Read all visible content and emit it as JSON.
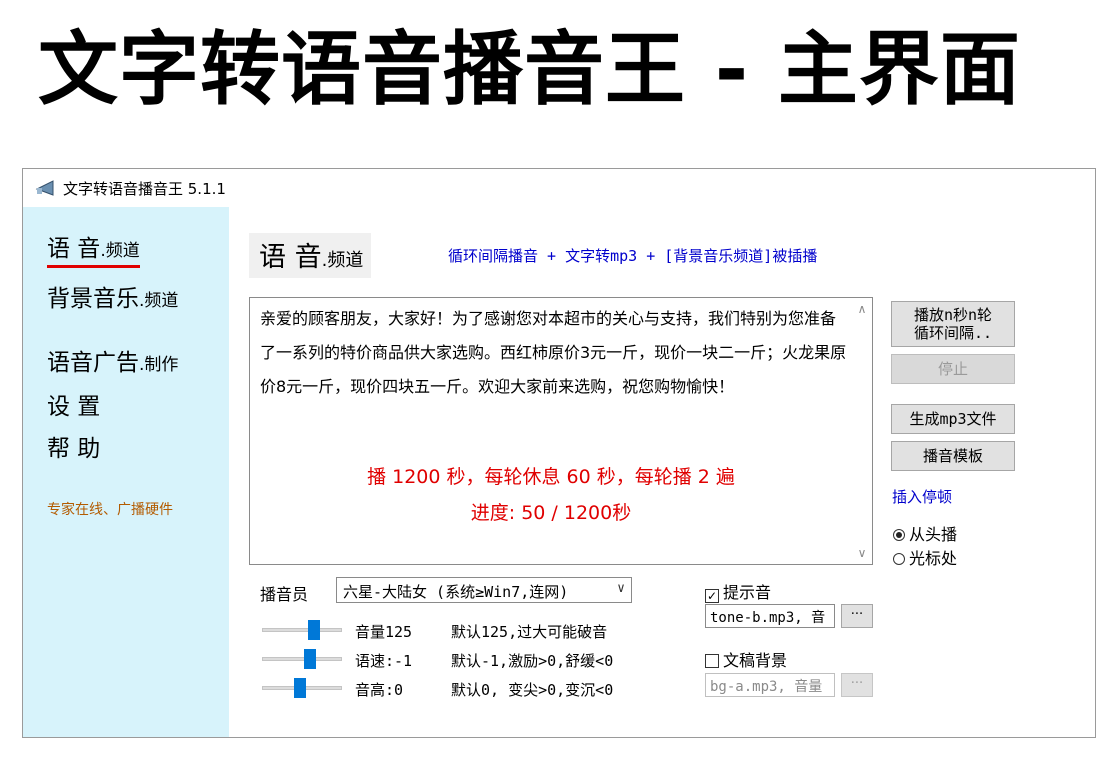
{
  "banner": {
    "title": "文字转语音播音王 - 主界面"
  },
  "window": {
    "title": "文字转语音播音王 5.1.1",
    "icon": "speaker-icon"
  },
  "sidebar": {
    "items": [
      {
        "main": "语 音",
        "sub": ".频道",
        "active": true
      },
      {
        "main": "背景音乐",
        "sub": ".频道"
      },
      {
        "main": "语音广告",
        "sub": ".制作"
      },
      {
        "main": "设 置",
        "sub": ""
      },
      {
        "main": "帮 助",
        "sub": ""
      }
    ],
    "help_sub": "专家在线、广播硬件"
  },
  "main": {
    "title_main": "语 音",
    "title_sub": ".频道",
    "feature_line": "循环间隔播音 + 文字转mp3 + [背景音乐频道]被插播",
    "text": "亲爱的顾客朋友，大家好！为了感谢您对本超市的关心与支持，我们特别为您准备了一系列的特价商品供大家选购。西红柿原价3元一斤，现价一块二一斤；火龙果原价8元一斤，现价四块五一斤。欢迎大家前来选购，祝您购物愉快！",
    "play_info": "播 1200 秒，每轮休息 60 秒，每轮播 2 遍",
    "progress": "进度:  50 / 1200秒"
  },
  "buttons": {
    "play_loop": "播放n秒n轮\n循环间隔..",
    "stop": "停止",
    "gen_mp3": "生成mp3文件",
    "template": "播音模板"
  },
  "insert_pause": "插入停顿",
  "radios": {
    "from_start": "从头播",
    "cursor": "光标处",
    "selected": "from_start"
  },
  "voice": {
    "label": "播音员",
    "selected": "六星-大陆女 (系统≥Win7,连网)",
    "sliders": [
      {
        "name": "音量125",
        "desc": "默认125,过大可能破音",
        "level": 0.68
      },
      {
        "name": "语速:-1",
        "desc": "默认-1,激励>0,舒缓<0",
        "level": 0.62
      },
      {
        "name": "音高:0",
        "desc": "默认0, 变尖>0,变沉<0",
        "level": 0.47
      }
    ]
  },
  "prompt_tone": {
    "label": "提示音",
    "checked": true,
    "value": "tone-b.mp3, 音",
    "browse": "···"
  },
  "bg_doc": {
    "label": "文稿背景",
    "checked": false,
    "value": "bg-a.mp3, 音量",
    "browse": "···"
  }
}
